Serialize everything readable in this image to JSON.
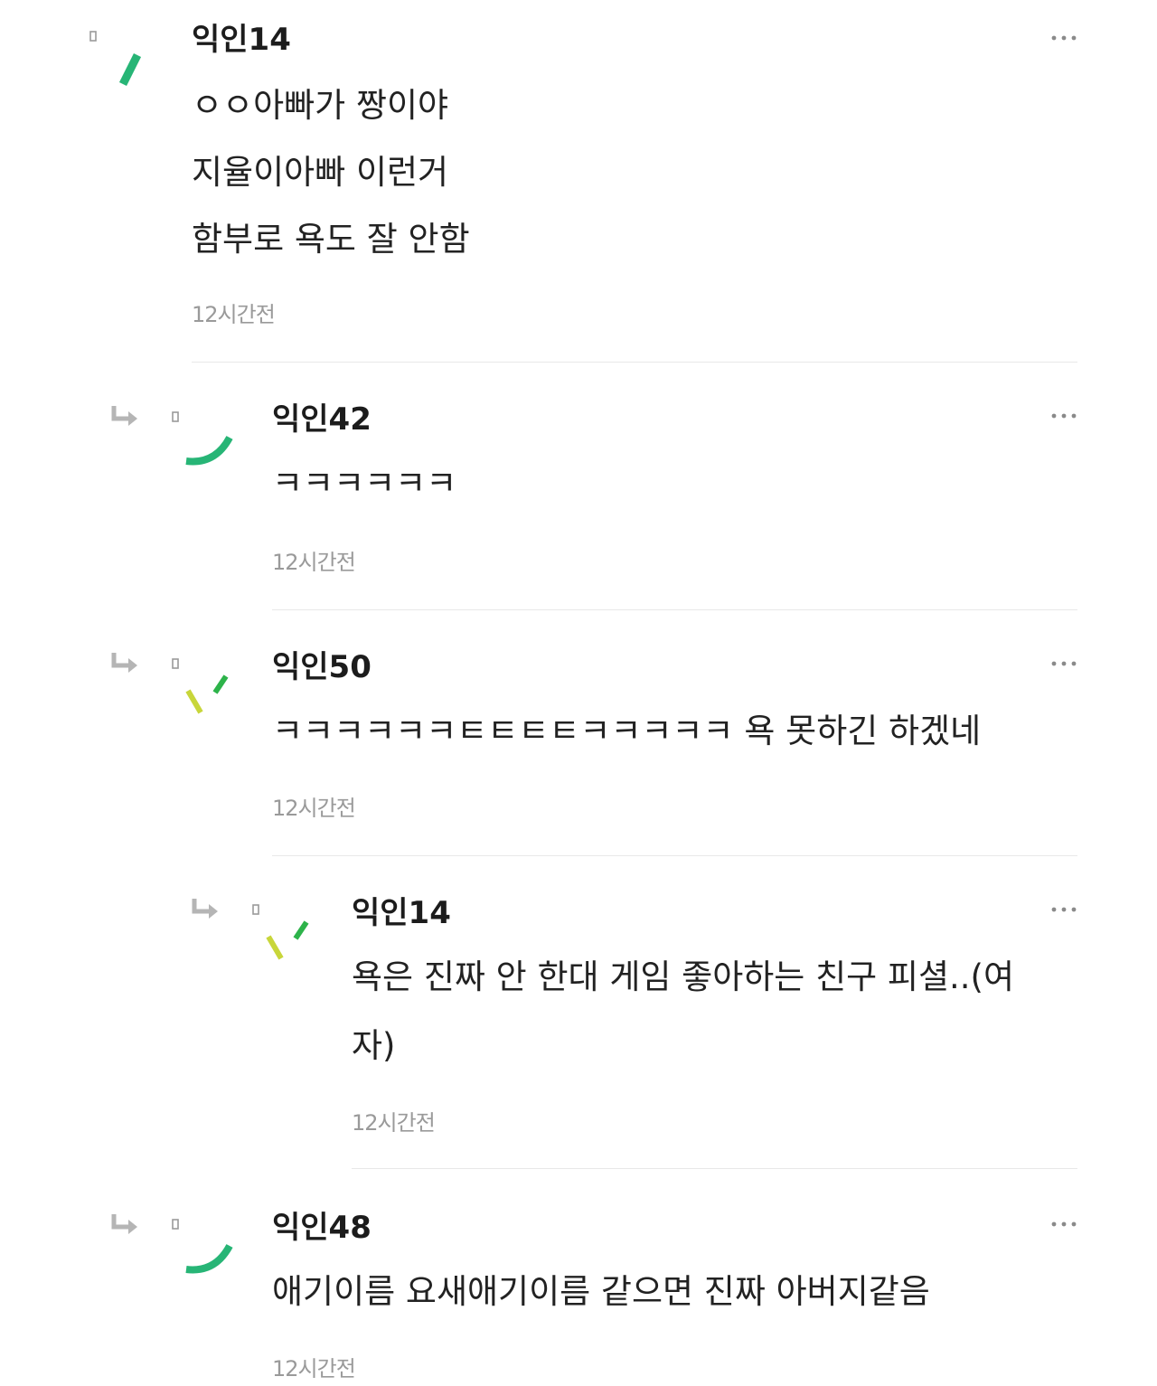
{
  "colors": {
    "avatar_green": "#27b576",
    "avatar_lime": "#c8d63a",
    "avatar_dark_green": "#2db34a",
    "reply_arrow": "#b5b5b5",
    "time_text": "#9a9a9a",
    "divider": "#e8e8e8"
  },
  "comments": [
    {
      "author": "익인14",
      "lines": [
        "ㅇㅇ아빠가 짱이야",
        "지율이아빠 이런거",
        "함부로 욕도 잘 안함"
      ],
      "time": "12시간전",
      "more_icon": "more-horizontal-icon",
      "avatar_icon": "slash-avatar-icon"
    },
    {
      "author": "익인42",
      "lines": [
        "ㅋㅋㅋㅋㅋㅋ"
      ],
      "time": "12시간전",
      "more_icon": "more-horizontal-icon",
      "reply_icon": "reply-arrow-icon",
      "avatar_icon": "smile-curve-avatar-icon"
    },
    {
      "author": "익인50",
      "lines": [
        "ㅋㅋㅋㅋㅋㅋㅌㅌㅌㅌㅋㅋㅋㅋㅋ 욕 못하긴 하겠네"
      ],
      "time": "12시간전",
      "more_icon": "more-horizontal-icon",
      "reply_icon": "reply-arrow-icon",
      "avatar_icon": "tick-marks-avatar-icon"
    },
    {
      "author": "익인14",
      "lines": [
        "욕은 진짜 안 한대 게임 좋아하는 친구 피셜..(여",
        "자)"
      ],
      "time": "12시간전",
      "more_icon": "more-horizontal-icon",
      "reply_icon": "reply-arrow-icon",
      "avatar_icon": "tick-marks-avatar-icon"
    },
    {
      "author": "익인48",
      "lines": [
        "애기이름 요새애기이름 같으면 진짜 아버지같음"
      ],
      "time": "12시간전",
      "more_icon": "more-horizontal-icon",
      "reply_icon": "reply-arrow-icon",
      "avatar_icon": "smile-curve-avatar-icon"
    }
  ]
}
